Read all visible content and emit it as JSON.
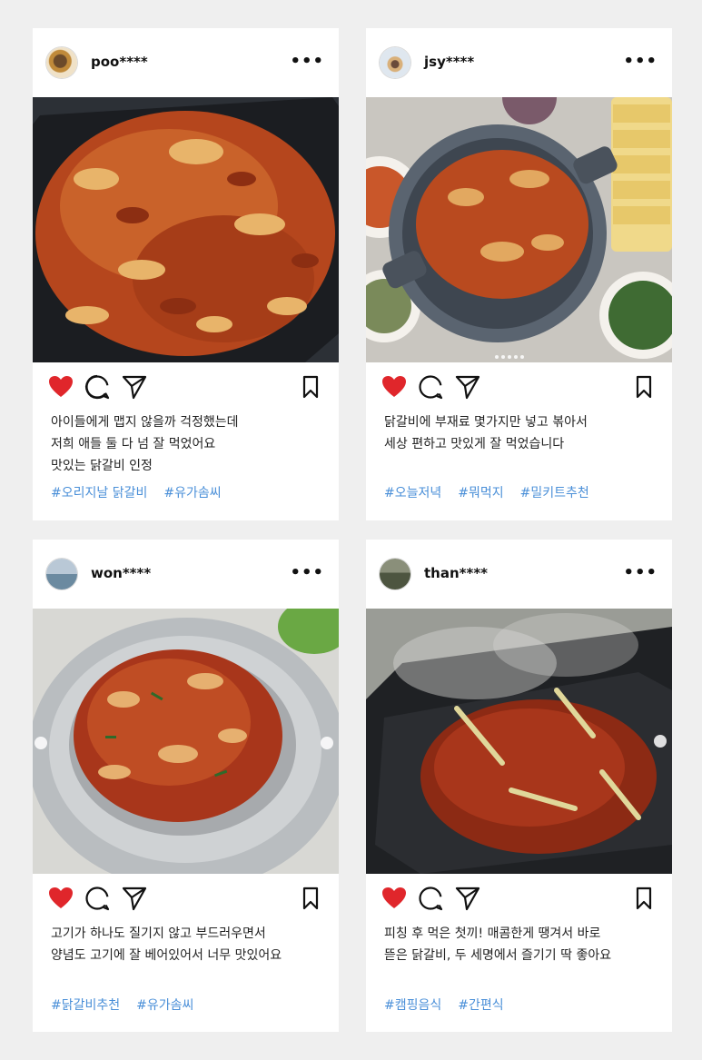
{
  "posts": [
    {
      "username": "poo****",
      "caption": [
        "아이들에게 맵지 않을까 걱정했는데",
        "저희 애들 둘 다 넘 잘 먹었어요",
        "맛있는 닭갈비 인정"
      ],
      "tags": [
        "#오리지날 닭갈비",
        "#유가솜씨"
      ],
      "image": "dakgalbi-on-electric-grill"
    },
    {
      "username": "jsy****",
      "caption": [
        "닭갈비에 부재료 몇가지만 넣고 볶아서",
        "세상 편하고 맛있게 잘 먹었습니다"
      ],
      "tags": [
        "#오늘저녁",
        "#뭐먹지",
        "#밀키트추천"
      ],
      "image": "dakgalbi-in-grill-pan-with-side-dishes"
    },
    {
      "username": "won****",
      "caption": [
        "고기가 하나도 질기지 않고 부드러우면서",
        "양념도 고기에 잘 베어있어서 너무 맛있어요"
      ],
      "tags": [
        "#닭갈비추천",
        "#유가솜씨"
      ],
      "image": "dakgalbi-on-plate"
    },
    {
      "username": "than****",
      "caption": [
        "피칭 후 먹은 첫끼! 매콤한게 땡겨서 바로",
        "뜯은 닭갈비, 두 세명에서 즐기기 딱 좋아요"
      ],
      "tags": [
        "#캠핑음식",
        "#간편식"
      ],
      "image": "dakgalbi-cooking-outdoors"
    }
  ],
  "icons": {
    "more": "more-options-icon",
    "like": "heart-icon",
    "comment": "comment-icon",
    "share": "share-icon",
    "save": "bookmark-icon"
  },
  "colors": {
    "background": "#efefef",
    "card": "#ffffff",
    "heart": "#e0262b",
    "hashtag": "#4a8fd8",
    "text": "#222222"
  }
}
